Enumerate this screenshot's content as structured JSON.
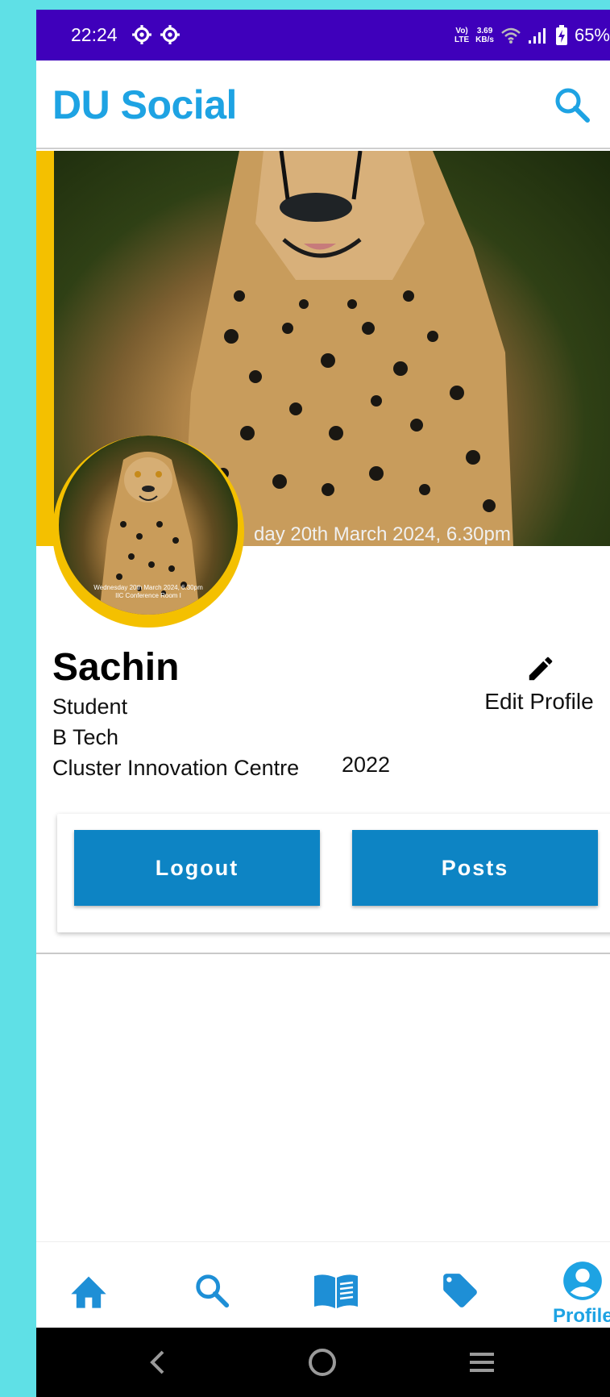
{
  "status_bar": {
    "time": "22:24",
    "network_type_top": "Vo)",
    "network_type_bottom": "LTE",
    "speed_value": "3.69",
    "speed_unit": "KB/s",
    "battery": "65%",
    "bg_color": "#3f00bb"
  },
  "app_bar": {
    "title": "DU Social",
    "search_icon": "search-icon",
    "accent": "#1ea3e3"
  },
  "cover": {
    "caption": "day 20th March 2024, 6.30pm",
    "frame_color": "#f4c000"
  },
  "avatar": {
    "caption_line1": "Wednesday 20th March 2024, 6.30pm",
    "caption_line2": "IIC Conference Room I"
  },
  "profile": {
    "name": "Sachin",
    "role": "Student",
    "program": "B Tech",
    "college": "Cluster Innovation Centre",
    "year": "2022",
    "edit_label": "Edit Profile"
  },
  "actions": {
    "logout_label": "Logout",
    "posts_label": "Posts",
    "button_color": "#0d84c4"
  },
  "bottom_nav": {
    "items": [
      {
        "icon": "home-icon"
      },
      {
        "icon": "search-icon"
      },
      {
        "icon": "book-icon"
      },
      {
        "icon": "tag-icon"
      },
      {
        "icon": "profile-icon",
        "label": "Profile"
      }
    ],
    "active_label": "Profile"
  },
  "system_nav": {
    "buttons": [
      "back-icon",
      "home-circle-icon",
      "menu-icon"
    ]
  }
}
